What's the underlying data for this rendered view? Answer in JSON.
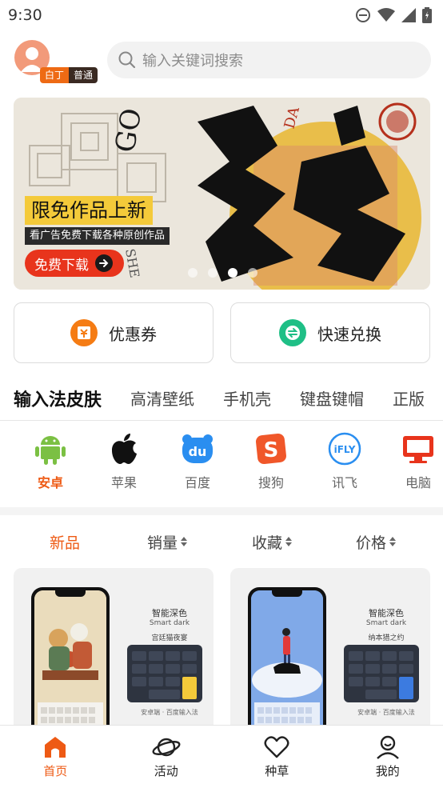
{
  "status_bar": {
    "time": "9:30"
  },
  "header": {
    "user_rank_badge": "白丁",
    "user_level_badge": "普通",
    "search_placeholder": "输入关键词搜索"
  },
  "banner": {
    "headline": "限免作品上新",
    "subtitle": "看广告免费下载各种原创作品",
    "button_label": "免费下载",
    "slide_count": 4,
    "active_slide": 3
  },
  "quick_actions": [
    {
      "label": "优惠券",
      "icon": "coupon-icon",
      "color": "#f57c14"
    },
    {
      "label": "快速兑换",
      "icon": "exchange-icon",
      "color": "#1fbf86"
    }
  ],
  "category_tabs": [
    "输入法皮肤",
    "高清壁纸",
    "手机壳",
    "键盘键帽",
    "正版"
  ],
  "active_tab": 0,
  "brands": [
    {
      "label": "安卓",
      "icon": "android-icon",
      "active": true
    },
    {
      "label": "苹果",
      "icon": "apple-icon",
      "active": false
    },
    {
      "label": "百度",
      "icon": "baidu-icon",
      "active": false
    },
    {
      "label": "搜狗",
      "icon": "sogou-icon",
      "active": false
    },
    {
      "label": "讯飞",
      "icon": "ifly-icon",
      "active": false
    },
    {
      "label": "电脑",
      "icon": "computer-icon",
      "active": false
    }
  ],
  "sort_options": [
    {
      "label": "新品",
      "active": true,
      "has_arrows": false
    },
    {
      "label": "销量",
      "active": false,
      "has_arrows": true
    },
    {
      "label": "收藏",
      "active": false,
      "has_arrows": true
    },
    {
      "label": "价格",
      "active": false,
      "has_arrows": true
    }
  ],
  "products": [
    {
      "tag_zh": "智能深色",
      "tag_en": "Smart dark",
      "theme_title": "宫廷猫夜宴",
      "footer": "安卓端 · 百度输入法"
    },
    {
      "tag_zh": "智能深色",
      "tag_en": "Smart dark",
      "theme_title": "纳本猎之约",
      "footer": "安卓端 · 百度输入法"
    }
  ],
  "bottom_nav": [
    {
      "label": "首页",
      "icon": "home-icon",
      "active": true
    },
    {
      "label": "活动",
      "icon": "planet-icon",
      "active": false
    },
    {
      "label": "种草",
      "icon": "heart-icon",
      "active": false
    },
    {
      "label": "我的",
      "icon": "profile-icon",
      "active": false
    }
  ],
  "colors": {
    "accent": "#ee5a14",
    "banner_button": "#e8341c",
    "headline_bg": "#f4ca3a"
  }
}
